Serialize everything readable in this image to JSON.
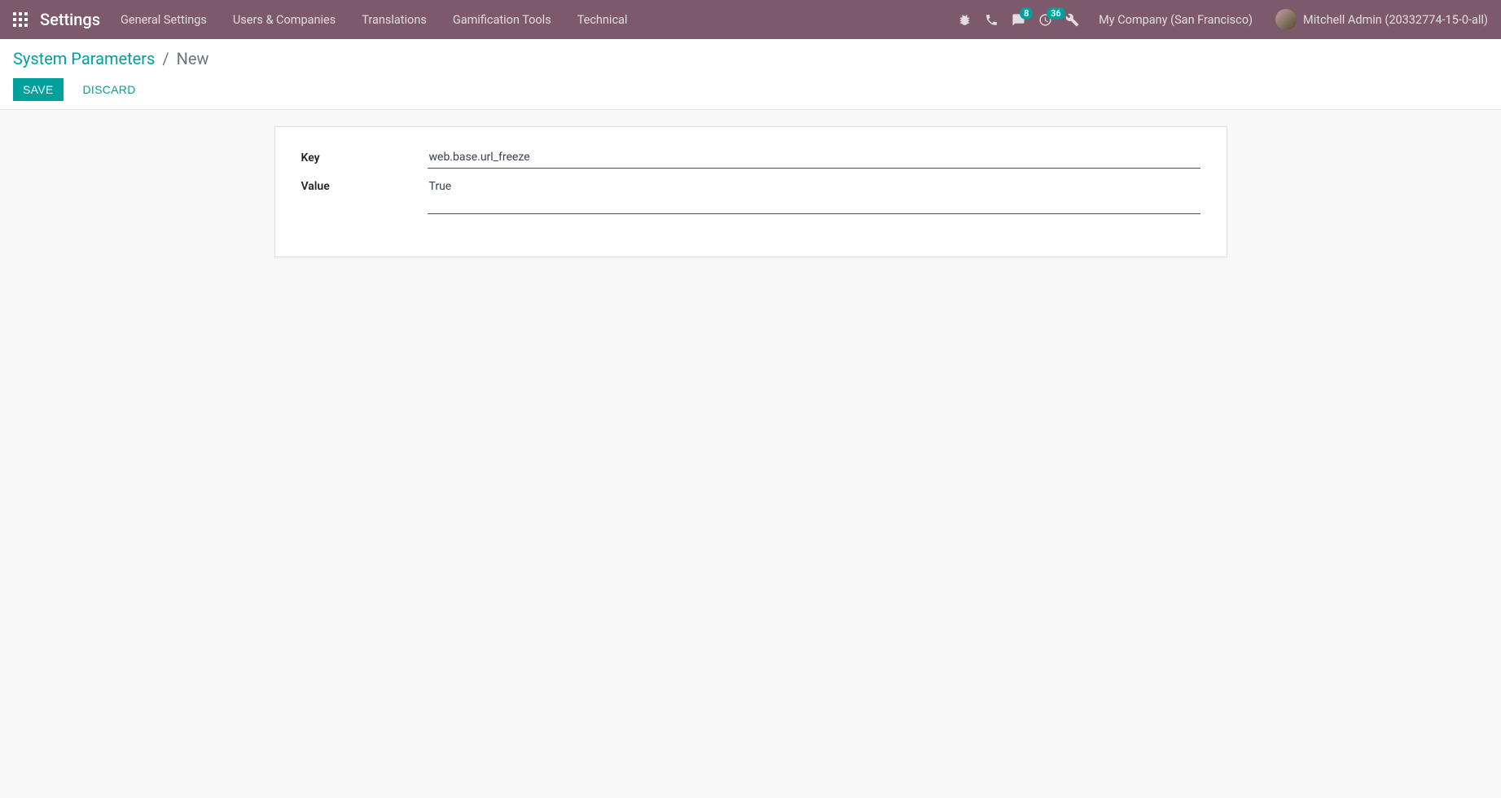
{
  "navbar": {
    "title": "Settings",
    "menu": [
      "General Settings",
      "Users & Companies",
      "Translations",
      "Gamification Tools",
      "Technical"
    ],
    "messaging_badge": "8",
    "activities_badge": "36",
    "company": "My Company (San Francisco)",
    "user": "Mitchell Admin (20332774-15-0-all)"
  },
  "breadcrumb": {
    "parent": "System Parameters",
    "current": "New"
  },
  "buttons": {
    "save": "Save",
    "discard": "Discard"
  },
  "form": {
    "key_label": "Key",
    "key_value": "web.base.url_freeze",
    "value_label": "Value",
    "value_value": "True"
  }
}
